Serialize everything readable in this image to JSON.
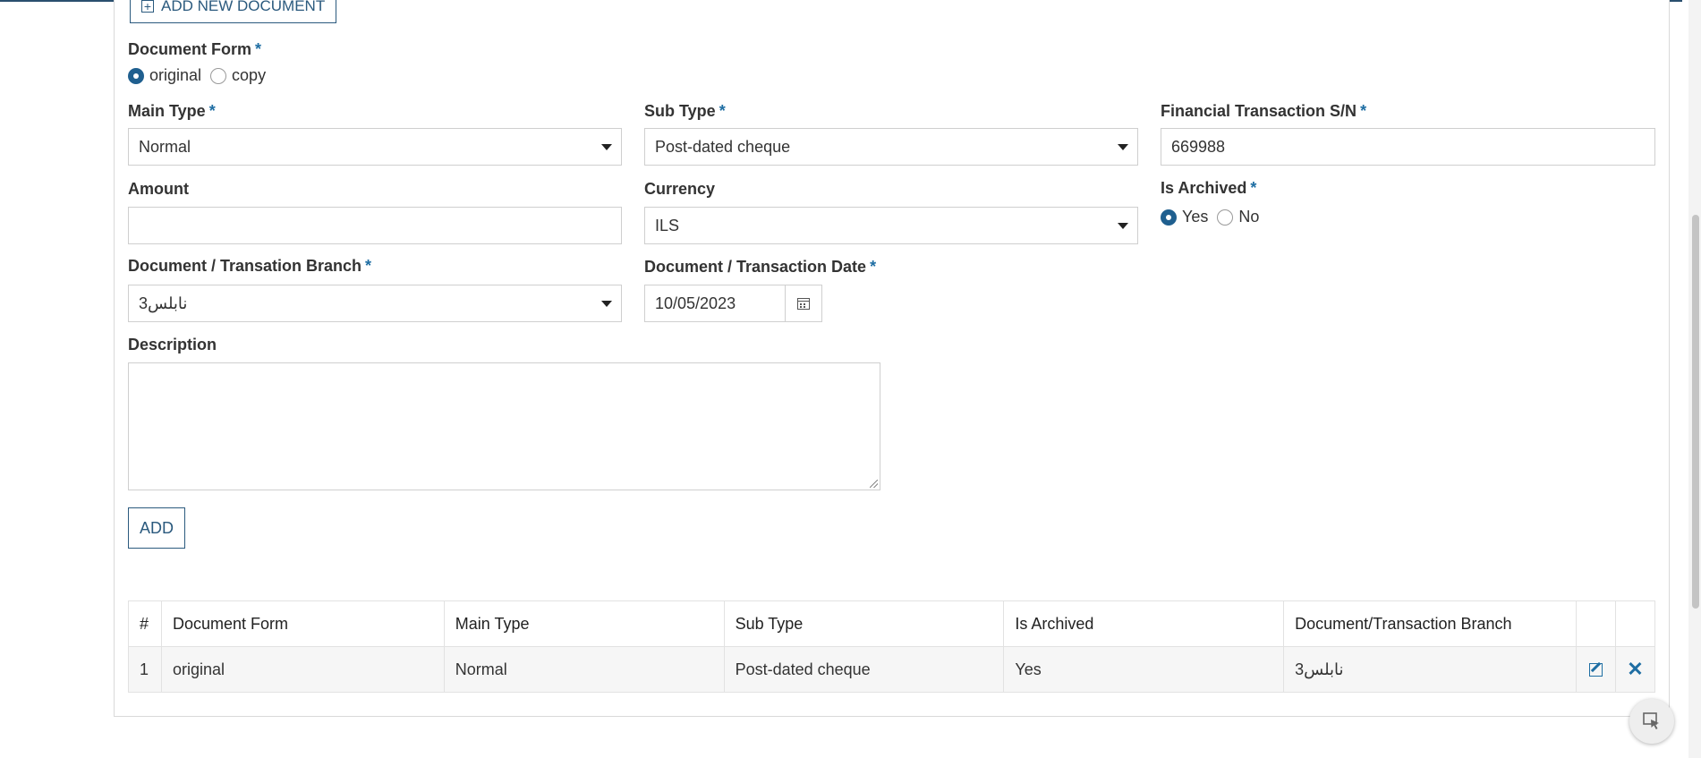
{
  "add_document_button": "ADD NEW DOCUMENT",
  "document_form": {
    "label": "Document Form",
    "options": [
      "original",
      "copy"
    ],
    "selected": "original"
  },
  "main_type": {
    "label": "Main Type",
    "value": "Normal"
  },
  "sub_type": {
    "label": "Sub Type",
    "value": "Post-dated cheque"
  },
  "financial_sn": {
    "label": "Financial Transaction S/N",
    "value": "669988"
  },
  "amount": {
    "label": "Amount",
    "value": ""
  },
  "currency": {
    "label": "Currency",
    "value": "ILS"
  },
  "is_archived": {
    "label": "Is Archived",
    "options": [
      "Yes",
      "No"
    ],
    "selected": "Yes"
  },
  "branch": {
    "label": "Document / Transation Branch",
    "value": "نابلس3"
  },
  "transaction_date": {
    "label": "Document / Transaction Date",
    "value": "10/05/2023"
  },
  "description": {
    "label": "Description",
    "value": ""
  },
  "add_button": "ADD",
  "required_mark": "*",
  "table": {
    "headers": [
      "#",
      "Document Form",
      "Main Type",
      "Sub Type",
      "Is Archived",
      "Document/Transaction Branch"
    ],
    "rows": [
      {
        "num": "1",
        "form": "original",
        "main_type": "Normal",
        "sub_type": "Post-dated cheque",
        "archived": "Yes",
        "branch": "نابلس3"
      }
    ]
  },
  "icons": {
    "add": "plus-square-icon",
    "calendar": "calendar-icon",
    "edit": "edit-icon",
    "delete": "close-icon",
    "floating": "cursor-select-icon"
  },
  "colors": {
    "accent": "#1f5f8f",
    "required": "#1f6ea3",
    "border": "#cfcfcf"
  }
}
